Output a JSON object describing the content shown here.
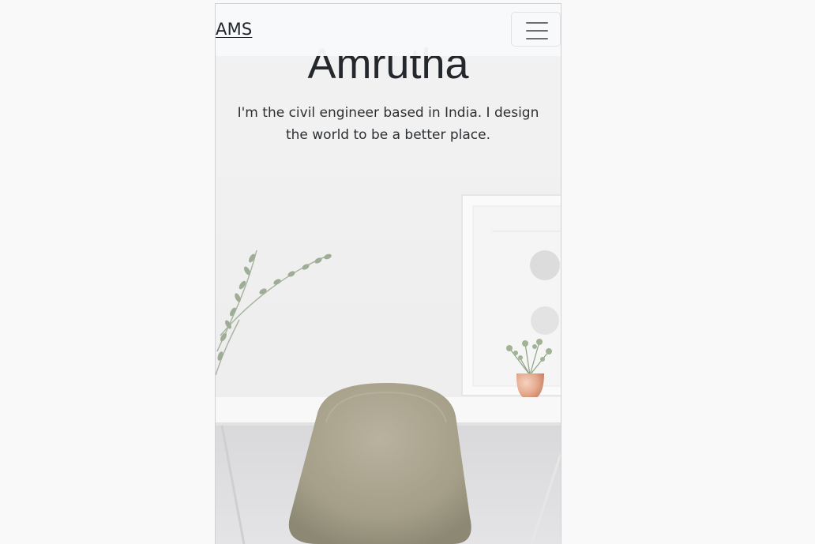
{
  "navbar": {
    "brand": "AMS",
    "toggle_icon": "hamburger-menu-icon"
  },
  "hero": {
    "title": "Amrutha",
    "subtitle": "I'm the civil engineer based in India. I design the world to be a better place.",
    "background": "desk-chair-photo"
  },
  "colors": {
    "page_bg": "#f9f9fa",
    "navbar_bg": "#f8f9fa",
    "text": "#212529"
  }
}
